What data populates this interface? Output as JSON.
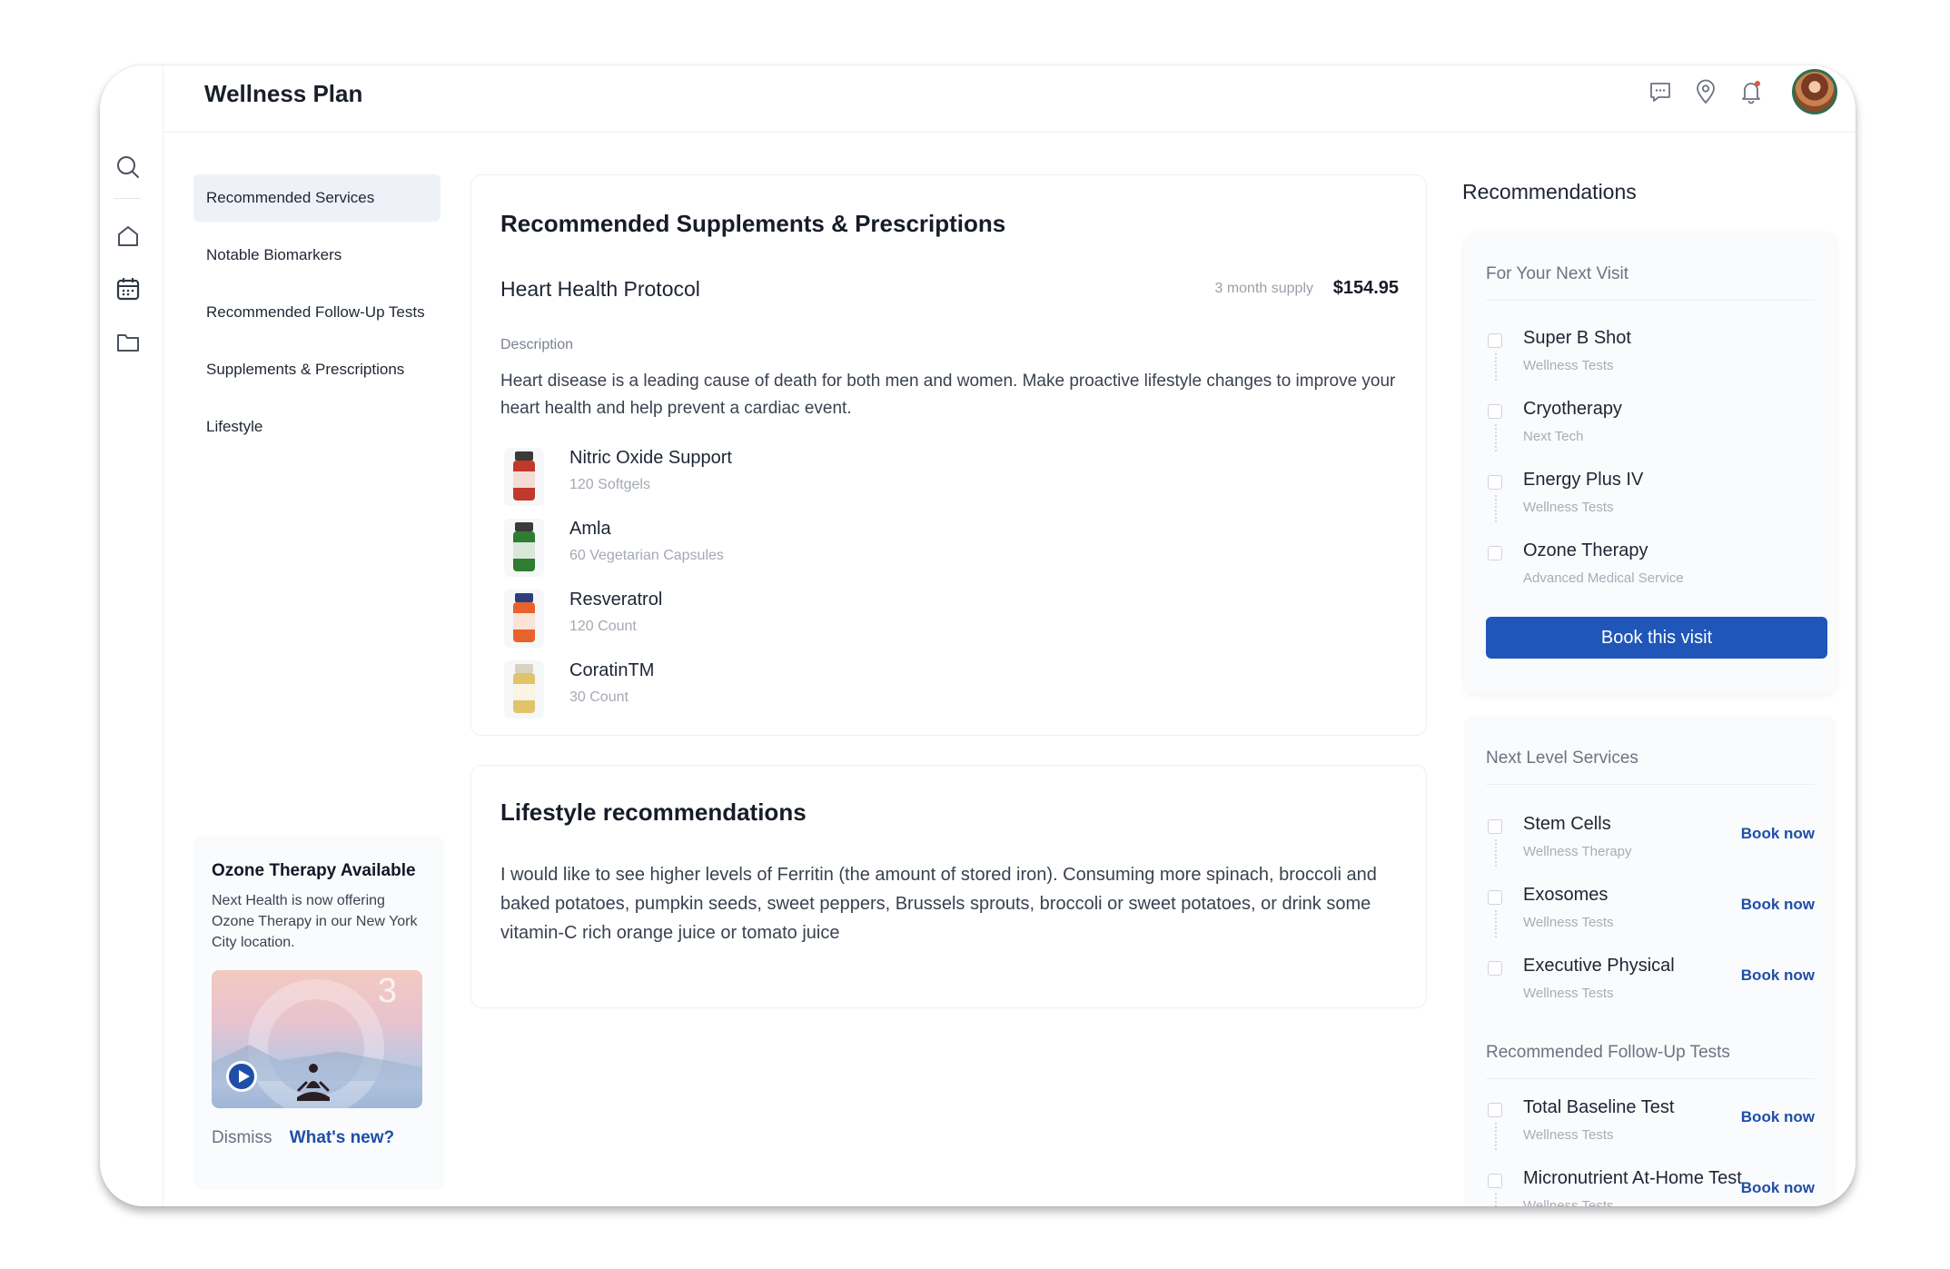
{
  "header": {
    "title": "Wellness Plan"
  },
  "nav": {
    "items": [
      {
        "label": "Recommended Services",
        "active": true
      },
      {
        "label": "Notable Biomarkers"
      },
      {
        "label": "Recommended Follow-Up Tests"
      },
      {
        "label": "Supplements & Prescriptions"
      },
      {
        "label": "Lifestyle"
      }
    ]
  },
  "promo": {
    "title": "Ozone Therapy Available",
    "text": "Next Health is now offering Ozone Therapy in our New York City location.",
    "video_number": "3",
    "dismiss": "Dismiss",
    "whats_new": "What's new?"
  },
  "supplements": {
    "title": "Recommended Supplements & Prescriptions",
    "protocol": "Heart Health Protocol",
    "supply": "3 month supply",
    "price": "$154.95",
    "description_label": "Description",
    "description": "Heart disease is a leading cause of death for both men and women. Make proactive lifestyle changes to improve your heart health and help prevent a cardiac event.",
    "products": [
      {
        "name": "Nitric Oxide Support",
        "sub": "120 Softgels",
        "color": "#c0392b"
      },
      {
        "name": "Amla",
        "sub": "60 Vegetarian Capsules",
        "color": "#2e7d32"
      },
      {
        "name": "Resveratrol",
        "sub": "120 Count",
        "color": "#e8632b"
      },
      {
        "name": "CoratinTM",
        "sub": "30 Count",
        "color": "#e0c36b"
      }
    ]
  },
  "lifestyle": {
    "title": "Lifestyle recommendations",
    "text": "I would like to see higher levels of Ferritin (the amount of stored iron). Consuming more  spinach, broccoli and baked potatoes, pumpkin seeds, sweet peppers, Brussels sprouts, broccoli or sweet potatoes, or drink some vitamin-C rich orange juice or tomato juice"
  },
  "recommendations": {
    "title": "Recommendations",
    "next_visit": {
      "title": "For Your Next Visit",
      "items": [
        {
          "name": "Super B Shot",
          "sub": "Wellness Tests"
        },
        {
          "name": "Cryotherapy",
          "sub": "Next Tech"
        },
        {
          "name": "Energy Plus IV",
          "sub": "Wellness Tests"
        },
        {
          "name": "Ozone Therapy",
          "sub": "Advanced Medical Service"
        }
      ],
      "button": "Book this visit"
    },
    "next_level": {
      "title": "Next Level Services",
      "items": [
        {
          "name": "Stem Cells",
          "sub": "Wellness Therapy",
          "action": "Book now"
        },
        {
          "name": "Exosomes",
          "sub": "Wellness Tests",
          "action": "Book now"
        },
        {
          "name": "Executive Physical",
          "sub": "Wellness Tests",
          "action": "Book now"
        }
      ]
    },
    "follow_up": {
      "title": "Recommended Follow-Up Tests",
      "items": [
        {
          "name": "Total Baseline Test",
          "sub": "Wellness Tests",
          "action": "Book now"
        },
        {
          "name": "Micronutrient At-Home Test",
          "sub": "Wellness Tests",
          "action": "Book now"
        }
      ]
    }
  },
  "colors": {
    "accent": "#1f56b8",
    "link": "#1f4ea8"
  }
}
